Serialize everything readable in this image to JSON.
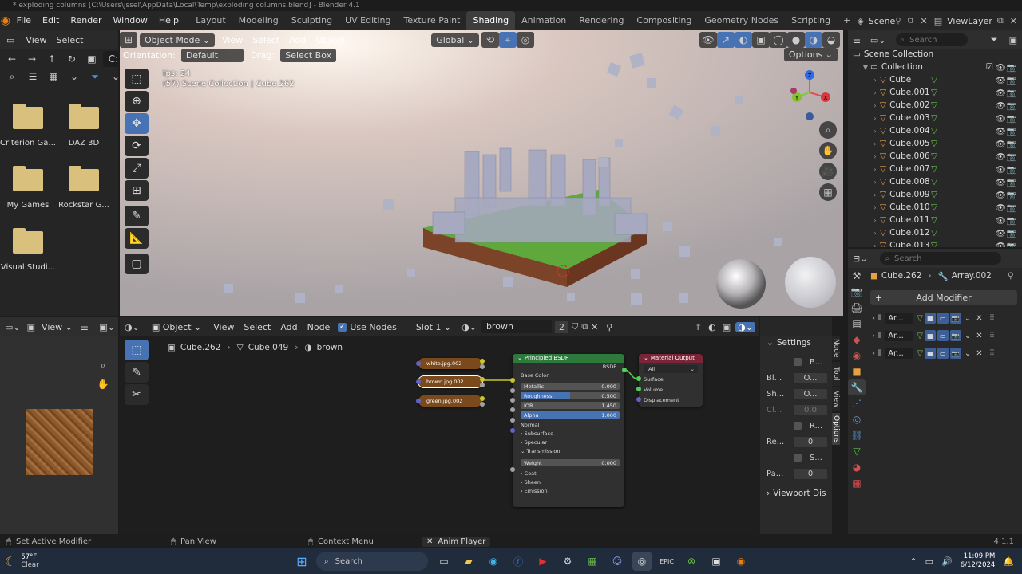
{
  "window": {
    "title": "* exploding columns [C:\\Users\\jssel\\AppData\\Local\\Temp\\exploding columns.blend] - Blender 4.1"
  },
  "menu": [
    "File",
    "Edit",
    "Render",
    "Window",
    "Help"
  ],
  "workspaces": [
    "Layout",
    "Modeling",
    "Sculpting",
    "UV Editing",
    "Texture Paint",
    "Shading",
    "Animation",
    "Rendering",
    "Compositing",
    "Geometry Nodes",
    "Scripting"
  ],
  "active_workspace": "Shading",
  "scene": {
    "name": "Scene",
    "view_layer": "ViewLayer"
  },
  "file_browser": {
    "menu": [
      "View",
      "Select"
    ],
    "path_short": "C:",
    "folders": [
      "Criterion Ga...",
      "DAZ 3D",
      "My Games",
      "Rockstar G...",
      "Visual Studi..."
    ]
  },
  "viewport": {
    "mode": "Object Mode",
    "menu": [
      "View",
      "Select",
      "Add",
      "Object"
    ],
    "transform": "Global",
    "orientation_label": "Orientation:",
    "orientation_value": "Default",
    "drag_label": "Drag:",
    "drag_value": "Select Box",
    "options_label": "Options",
    "overlay_fps": "fps: 24",
    "overlay_info": "(57) Scene Collection | Cube.262",
    "gizmo_axes": {
      "x": "X",
      "y": "Y",
      "z": "Z"
    }
  },
  "outliner": {
    "search_placeholder": "Search",
    "root": "Scene Collection",
    "collection": "Collection",
    "items": [
      "Cube",
      "Cube.001",
      "Cube.002",
      "Cube.003",
      "Cube.004",
      "Cube.005",
      "Cube.006",
      "Cube.007",
      "Cube.008",
      "Cube.009",
      "Cube.010",
      "Cube.011",
      "Cube.012",
      "Cube.013"
    ]
  },
  "properties": {
    "search_placeholder": "Search",
    "object": "Cube.262",
    "modifier_path": "Array.002",
    "add_modifier": "Add Modifier",
    "modifiers": [
      "Ar...",
      "Ar...",
      "Ar..."
    ]
  },
  "image_editor": {
    "view_label": "View"
  },
  "node_editor": {
    "type": "Object",
    "menu": [
      "View",
      "Select",
      "Add",
      "Node"
    ],
    "use_nodes_label": "Use Nodes",
    "slot": "Slot 1",
    "material": "brown",
    "users": "2",
    "breadcrumb": [
      "Cube.262",
      "Cube.049",
      "brown"
    ],
    "texture_nodes": [
      "white.jpg.002",
      "brown.jpg.002",
      "green.jpg.002"
    ],
    "bsdf": {
      "title": "Principled BSDF",
      "output": "BSDF",
      "base_color": "Base Color",
      "fields": [
        {
          "label": "Metallic",
          "value": "0.000",
          "fill": 0.0
        },
        {
          "label": "Roughness",
          "value": "0.500",
          "fill": 0.5
        },
        {
          "label": "IOR",
          "value": "1.450",
          "fill": 0.0
        },
        {
          "label": "Alpha",
          "value": "1.000",
          "fill": 1.0
        }
      ],
      "normal": "Normal",
      "sections": [
        "Subsurface",
        "Specular",
        "Transmission"
      ],
      "weight": {
        "label": "Weight",
        "value": "0.000"
      },
      "sections2": [
        "Coat",
        "Sheen",
        "Emission"
      ]
    },
    "output_node": {
      "title": "Material Output",
      "target": "All",
      "inputs": [
        "Surface",
        "Volume",
        "Displacement"
      ]
    },
    "sidebar": {
      "settings": "Settings",
      "rows": [
        {
          "label": "",
          "value": "B..."
        },
        {
          "label": "Bl...",
          "value": "O..."
        },
        {
          "label": "Sh...",
          "value": "O..."
        },
        {
          "label": "Cl...",
          "value": "0.0"
        },
        {
          "label": "",
          "value": "R..."
        },
        {
          "label": "Re...",
          "value": "0"
        },
        {
          "label": "",
          "value": "S..."
        },
        {
          "label": "Pa...",
          "value": "0"
        }
      ],
      "viewport_display": "Viewport Dis",
      "tabs": [
        "Node",
        "Tool",
        "View",
        "Options"
      ]
    }
  },
  "statusbar": {
    "left": "Set Active Modifier",
    "mid": "Pan View",
    "context": "Context Menu",
    "center": "Anim Player",
    "version": "4.1.1"
  },
  "taskbar": {
    "weather_temp": "57°F",
    "weather_desc": "Clear",
    "search": "Search",
    "time": "11:09 PM",
    "date": "6/12/2024"
  }
}
